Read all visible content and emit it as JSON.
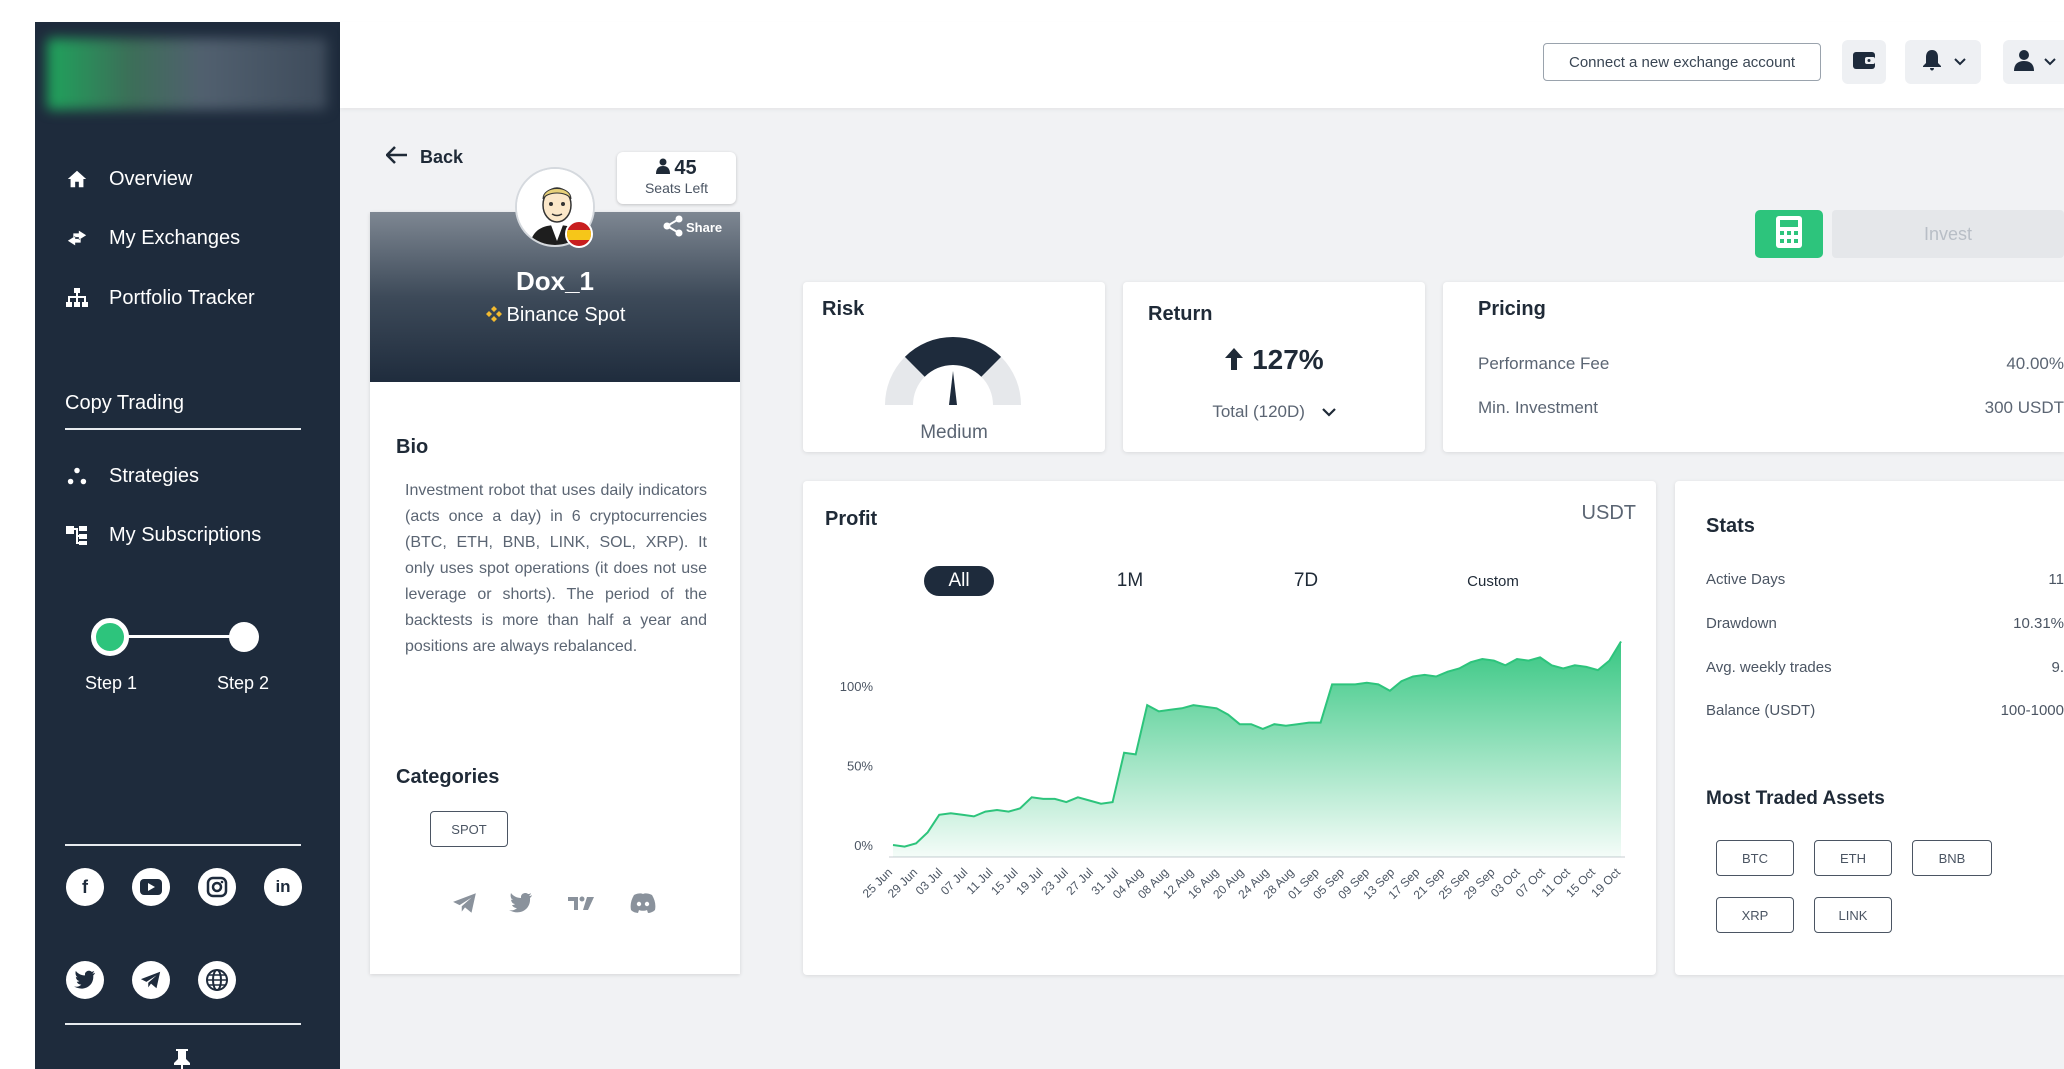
{
  "sidebar": {
    "items": [
      {
        "label": "Overview",
        "icon": "home-icon"
      },
      {
        "label": "My Exchanges",
        "icon": "exchange-icon"
      },
      {
        "label": "Portfolio Tracker",
        "icon": "hierarchy-icon"
      }
    ],
    "section_title": "Copy Trading",
    "copy_items": [
      {
        "label": "Strategies",
        "icon": "dots-icon"
      },
      {
        "label": "My Subscriptions",
        "icon": "subscriptions-icon"
      }
    ],
    "steps": [
      "Step 1",
      "Step 2"
    ],
    "socials": [
      "facebook-icon",
      "youtube-icon",
      "instagram-icon",
      "linkedin-icon",
      "twitter-icon",
      "telegram-icon",
      "globe-icon"
    ]
  },
  "topbar": {
    "connect_label": "Connect a new exchange account"
  },
  "profile": {
    "back_label": "Back",
    "seats_count": "45",
    "seats_label": "Seats Left",
    "share_label": "Share",
    "name": "Dox_1",
    "exchange": "Binance Spot",
    "bio_title": "Bio",
    "bio": "Investment robot that uses daily indicators (acts once a day) in 6 cryptocurrencies (BTC, ETH, BNB, LINK, SOL, XRP). It only uses spot operations (it does not use leverage or shorts). The period of the backtests is more than half a year and positions are always rebalanced.",
    "categories_title": "Categories",
    "categories": [
      "SPOT"
    ]
  },
  "actions": {
    "invest_label": "Invest"
  },
  "risk": {
    "title": "Risk",
    "level": "Medium"
  },
  "return": {
    "title": "Return",
    "value": "127%",
    "period": "Total (120D)"
  },
  "pricing": {
    "title": "Pricing",
    "rows": [
      {
        "label": "Performance Fee",
        "value": "40.00%"
      },
      {
        "label": "Min. Investment",
        "value": "300 USDT"
      }
    ]
  },
  "profit": {
    "title": "Profit",
    "currency": "USDT",
    "ranges": [
      "All",
      "1M",
      "7D",
      "Custom"
    ],
    "active_range": "All"
  },
  "stats": {
    "title": "Stats",
    "rows": [
      {
        "label": "Active Days",
        "value": "11"
      },
      {
        "label": "Drawdown",
        "value": "10.31%"
      },
      {
        "label": "Avg. weekly trades",
        "value": "9."
      },
      {
        "label": "Balance (USDT)",
        "value": "100-1000"
      }
    ],
    "assets_title": "Most Traded Assets",
    "assets": [
      "BTC",
      "ETH",
      "BNB",
      "XRP",
      "LINK"
    ]
  },
  "chart_data": {
    "type": "area",
    "title": "Profit",
    "ylabel": "",
    "xlabel": "",
    "ylim": [
      0,
      125
    ],
    "yticks": [
      "0%",
      "50%",
      "100%"
    ],
    "x_tick_labels": [
      "25 Jun",
      "29 Jun",
      "03 Jul",
      "07 Jul",
      "11 Jul",
      "15 Jul",
      "19 Jul",
      "23 Jul",
      "27 Jul",
      "31 Jul",
      "04 Aug",
      "08 Aug",
      "12 Aug",
      "16 Aug",
      "20 Aug",
      "24 Aug",
      "28 Aug",
      "01 Sep",
      "05 Sep",
      "09 Sep",
      "13 Sep",
      "17 Sep",
      "21 Sep",
      "25 Sep",
      "29 Sep",
      "03 Oct",
      "07 Oct",
      "11 Oct",
      "15 Oct",
      "19 Oct"
    ],
    "series": [
      {
        "values": [
          0,
          -1,
          1,
          8,
          19,
          20,
          19,
          18,
          21,
          22,
          21,
          23,
          30,
          29,
          29,
          27,
          30,
          28,
          26,
          27,
          58,
          57,
          88,
          84,
          85,
          86,
          88,
          87,
          86,
          82,
          76,
          76,
          73,
          76,
          75,
          76,
          77,
          77,
          101,
          101,
          101,
          102,
          101,
          97,
          103,
          106,
          107,
          106,
          109,
          111,
          115,
          117,
          116,
          113,
          117,
          116,
          118,
          113,
          111,
          113,
          112,
          110,
          116,
          128
        ]
      }
    ],
    "color": "#2dc47c"
  }
}
